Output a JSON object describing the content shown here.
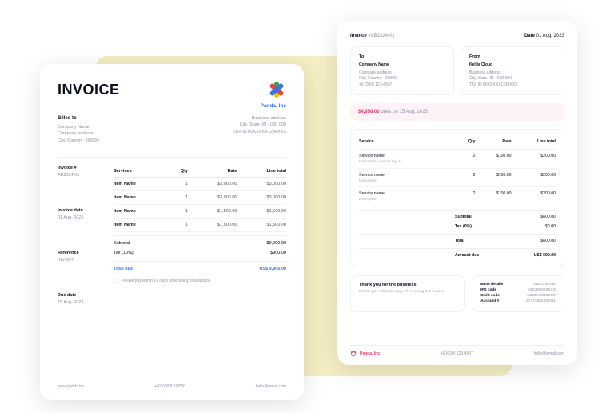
{
  "left": {
    "title": "INVOICE",
    "brand": "Panda, Inc",
    "billed": {
      "label": "Billed to",
      "company": "Company Name",
      "addr1": "Company address",
      "addr2": "City, Country - 00000"
    },
    "biz": {
      "addr1": "Business address",
      "addr2": "City, State, IN - 000 000",
      "tax": "TAX ID 00XXXXX1234XXX"
    },
    "meta": {
      "invno_lbl": "Invoice #",
      "invno": "AB2324-01",
      "date_lbl": "Invoice date",
      "date": "01 Aug, 2023",
      "ref_lbl": "Reference",
      "ref": "INV-057",
      "due_lbl": "Due date",
      "due": "15 Aug, 2023"
    },
    "headers": {
      "svc": "Services",
      "qty": "Qty",
      "rate": "Rate",
      "total": "Line total"
    },
    "items": [
      {
        "name": "Item Name",
        "qty": "1",
        "rate": "$3,000.00",
        "total": "$3,000.00"
      },
      {
        "name": "Item Name",
        "qty": "1",
        "rate": "$3,000.00",
        "total": "$3,000.00"
      },
      {
        "name": "Item Name",
        "qty": "1",
        "rate": "$1,500.00",
        "total": "$1,500.00"
      },
      {
        "name": "Item Name",
        "qty": "1",
        "rate": "$1,500.00",
        "total": "$1,500.00"
      }
    ],
    "totals": {
      "sub_k": "Subtotal",
      "sub_v": "$9,000.00",
      "tax_k": "Tax (10%)",
      "tax_v": "$900.00",
      "due_k": "Total due",
      "due_v": "US$ 9,900.00"
    },
    "terms": "Please pay within 15 days of receiving this invoice.",
    "footer": {
      "web": "www.panda.inc",
      "phone": "+91 00000 00000",
      "email": "hello@email.com"
    }
  },
  "right": {
    "top": {
      "inv_k": "Invoice",
      "inv_v": "#AB2324-01",
      "date_k": "Date",
      "date_v": "01 Aug, 2023"
    },
    "to": {
      "label": "To",
      "name": "Company Name",
      "addr1": "Company address",
      "addr2": "City, Country - 00000",
      "phone": "+0 (000) 123-4567"
    },
    "from": {
      "label": "From",
      "name": "Kelda Cloud",
      "addr1": "Business address",
      "addr2": "City, State, IN - 000 000",
      "tax": "TAX ID 00XXXXX1234XXX"
    },
    "dues": {
      "amount": "$4,950.00",
      "text": " dues on 15 Aug, 2023"
    },
    "headers": {
      "svc": "Service",
      "qty": "Qty",
      "rate": "Rate",
      "total": "Line total"
    },
    "rows": [
      {
        "name": "Service name",
        "desc": "Description • Hours log ↗",
        "qty": "2",
        "rate": "$100.00",
        "total": "$200.00"
      },
      {
        "name": "Service name",
        "desc": "Description",
        "qty": "2",
        "rate": "$100.00",
        "total": "$200.00"
      },
      {
        "name": "Service name",
        "desc": "Description",
        "qty": "2",
        "rate": "$100.00",
        "total": "$200.00"
      }
    ],
    "totals": {
      "sub_k": "Subtotal",
      "sub_v": "$600.00",
      "tax_k": "Tax (0%)",
      "tax_v": "$0.00",
      "tot_k": "Total",
      "tot_v": "$600.00",
      "due_k": "Amount due",
      "due_v": "US$ 600.00"
    },
    "thanks": {
      "title": "Thank you for the business!",
      "sub": "Please pay within 15 days of receiving this invoice."
    },
    "bank": {
      "l1k": "Bank details",
      "l1v": "ABCD BANK",
      "l2k": "IFS code",
      "l2v": "ABCD000XXXX",
      "l3k": "Swift code",
      "l3v": "ABCDUSBBXXX",
      "l4k": "Account #",
      "l4v": "37474892300011"
    },
    "footer": {
      "brand": "Panda, Inc",
      "phone": "+0 (000) 123-4567",
      "email": "hello@email.com"
    }
  }
}
